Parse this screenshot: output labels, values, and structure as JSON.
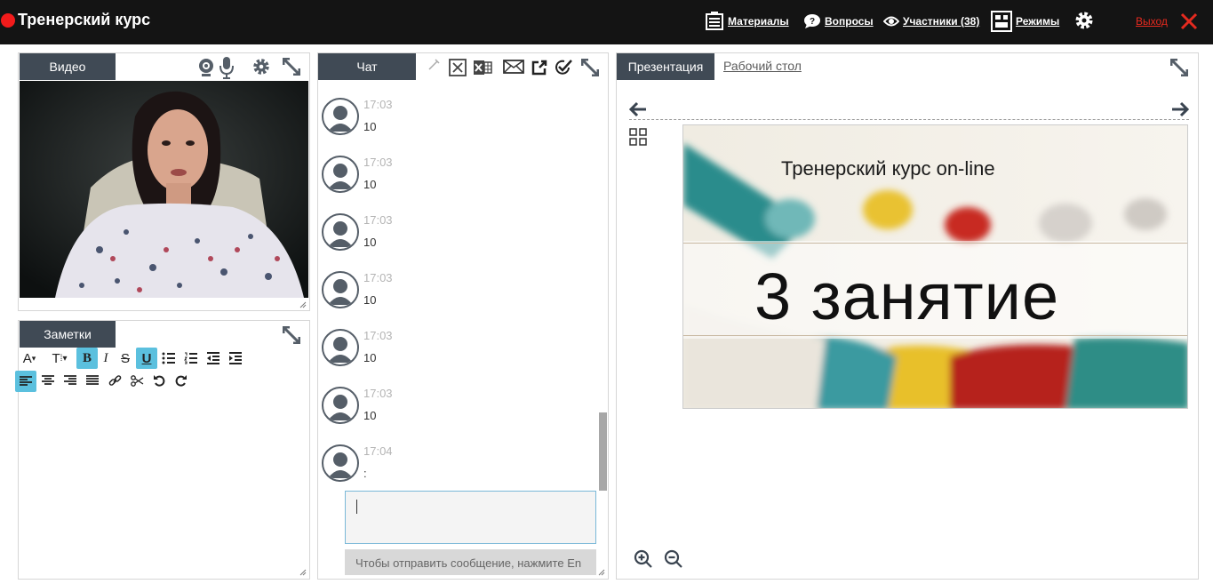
{
  "app": {
    "title": "Тренерский курс",
    "recording_color": "#f21b1b"
  },
  "topbar": {
    "materials": "Материалы",
    "questions": "Вопросы",
    "participants": "Участники (38)",
    "modes": "Режимы",
    "exit": "Выход"
  },
  "video_panel": {
    "tab": "Видео"
  },
  "notes_panel": {
    "tab": "Заметки",
    "font_btn": "A",
    "size_btn": "T",
    "bold": "B",
    "italic": "I",
    "strike": "S",
    "underline": "U"
  },
  "chat_panel": {
    "tab": "Чат",
    "messages": [
      {
        "time": "17:03",
        "text": "10"
      },
      {
        "time": "17:03",
        "text": "10"
      },
      {
        "time": "17:03",
        "text": "10"
      },
      {
        "time": "17:03",
        "text": "10"
      },
      {
        "time": "17:03",
        "text": "10"
      },
      {
        "time": "17:03",
        "text": "10"
      },
      {
        "time": "17:04",
        "text": ":"
      }
    ],
    "input_value": "",
    "hint": "Чтобы отправить сообщение, нажмите En"
  },
  "presentation_panel": {
    "tab": "Презентация",
    "desktop_tab": "Рабочий стол",
    "slide": {
      "subtitle": "Тренерский курс on-line",
      "title": "3 занятие"
    }
  },
  "colors": {
    "tab_bg": "#404a55",
    "accent": "#5bc0de",
    "exit": "#e52a1f"
  }
}
